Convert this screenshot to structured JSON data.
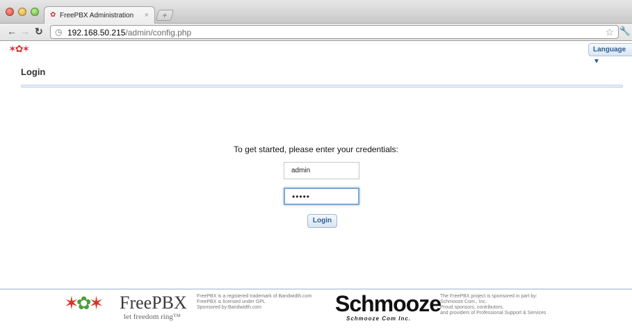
{
  "browser": {
    "tab_title": "FreePBX Administration",
    "tab_close": "×",
    "new_tab": "+",
    "url_host": "192.168.50.215",
    "url_path": "/admin/config.php"
  },
  "header": {
    "language_label": "Language ▼"
  },
  "main": {
    "title": "Login",
    "prompt": "To get started, please enter your credentials:",
    "username_value": "admin",
    "password_value": "•••••",
    "login_label": "Login"
  },
  "footer": {
    "freepbx_name": "FreePBX",
    "freepbx_tagline": "let freedom ring™",
    "freepbx_notes": [
      "FreePBX is a registered trademark of Bandwidth.com",
      "FreePBX is licensed under GPL",
      "Sponsored by:Bandwidth.com"
    ],
    "schmooze_name": "Schmooze",
    "schmooze_sub": "Schmooze Com Inc.",
    "sponsor_notes": [
      "The FreePBX project is sponsored in part by:",
      "Schmooze Com., Inc.",
      "Proud sponsors, contributors,",
      "and providers of Professional Support & Services"
    ]
  },
  "icons": {
    "back": "back-arrow-icon",
    "forward": "forward-arrow-icon",
    "reload": "reload-icon",
    "star": "bookmark-star-icon",
    "wrench": "wrench-icon",
    "globe": "globe-icon"
  }
}
